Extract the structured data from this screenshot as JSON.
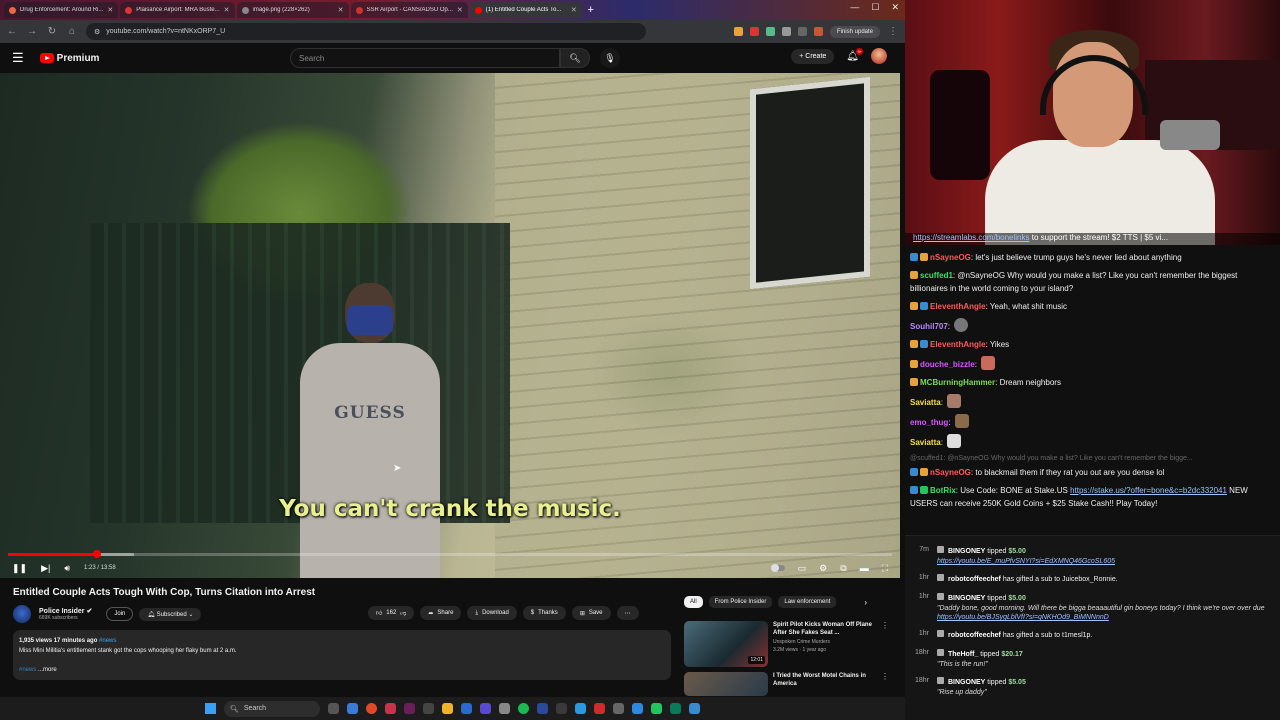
{
  "browser": {
    "tabs": [
      {
        "label": "Drug Enforcement: Around Ri..."
      },
      {
        "label": "Plaisance Airport: MRA Buste..."
      },
      {
        "label": "image.png (228×262)"
      },
      {
        "label": "SSR Airport - CANS/ADSU Op..."
      },
      {
        "label": "(1) Entitled Couple Acts To..."
      }
    ],
    "url": "youtube.com/watch?v=ntNKxORP7_U",
    "finish_update": "Finish update"
  },
  "youtube": {
    "logo_text": "Premium",
    "search_placeholder": "Search",
    "create_label": "Create",
    "notif_count": "9+",
    "caption": "You can't crank the music.",
    "time": "1:23 / 13:58",
    "progress_played": 0.101,
    "progress_loaded": 0.143,
    "title": "Entitled Couple Acts Tough With Cop, Turns Citation into Arrest",
    "channel": {
      "name": "Police Insider",
      "subs": "669K subscribers",
      "join": "Join",
      "subscribed": "Subscribed"
    },
    "actions": {
      "likes": "162",
      "share": "Share",
      "download": "Download",
      "thanks": "Thanks",
      "save": "Save"
    },
    "desc": {
      "meta": "1,935 views  17 minutes ago",
      "meta_tag": "#news",
      "text": "Miss Mini Militia's entitlement stank got the cops whooping her flaky bum at 2 a.m.",
      "tag": "#news",
      "more": "...more"
    },
    "chips": [
      "All",
      "From Police Insider",
      "Law enforcement"
    ],
    "recs": [
      {
        "title": "Spirit Pilot Kicks Woman Off Plane After She Fakes Seat ...",
        "channel": "Unspoken Crime Murders",
        "stats": "3.2M views · 1 year ago",
        "duration": "12:01"
      },
      {
        "title": "I Tried the Worst Motel Chains in America",
        "channel": "",
        "stats": "",
        "duration": ""
      }
    ]
  },
  "taskbar": {
    "search": "Search"
  },
  "stream": {
    "ticker_link": "https://streamlabs.com/bonelinks",
    "ticker_rest": " to support the stream! $2 TTS | $5 vi..."
  },
  "chat": [
    {
      "user": "nSayneOG",
      "color": "#ff5a5a",
      "text": "let's just believe trump guys he's never lied about anything"
    },
    {
      "user": "scuffed1",
      "color": "#3de06b",
      "text": "@nSayneOG Why would you make a list? Like you can't remember the biggest billionaires in the world coming to your island?"
    },
    {
      "user": "EleventhAngle",
      "color": "#ff5a5a",
      "text": "Yeah, what shit music"
    },
    {
      "user": "Souhil707",
      "color": "#b986ff",
      "text": ""
    },
    {
      "user": "EleventhAngle",
      "color": "#ff5a5a",
      "text": "Yikes"
    },
    {
      "user": "douche_bizzle",
      "color": "#d957ff",
      "text": ""
    },
    {
      "user": "MCBurningHammer",
      "color": "#7ed957",
      "text": "Dream neighbors"
    },
    {
      "user": "Saviatta",
      "color": "#f5e04a",
      "text": ""
    },
    {
      "user": "emo_thug",
      "color": "#d957ff",
      "text": ""
    },
    {
      "user": "Saviatta",
      "color": "#f5e04a",
      "text": ""
    },
    {
      "reply": "@scuffed1: @nSayneOG Why would you make a list? Like you can't remember the bigge..."
    },
    {
      "user": "nSayneOG",
      "color": "#ff5a5a",
      "text": "to blackmail them if they rat you out are you dense lol"
    },
    {
      "user": "BotRix",
      "color": "#3de06b",
      "text": "Use Code: BONE at Stake.US",
      "link": "https://stake.us/?offer=bone&c=b2dc332041",
      "text2": "NEW USERS can receive 250K Gold Coins + $25 Stake Cash!! Play Today!"
    }
  ],
  "tips": [
    {
      "time": "7m",
      "who": "BINGONEY",
      "action": "tipped",
      "amount": "$5.00",
      "msg": "",
      "link": "https://youtu.be/E_muPfvSNYI?si=EdXMNQ46GcoSL605"
    },
    {
      "time": "1hr",
      "who": "robotcoffeechef",
      "action": "has gifted a sub to Juicebox_Ronnie.",
      "amount": "",
      "msg": "",
      "link": ""
    },
    {
      "time": "1hr",
      "who": "BINGONEY",
      "action": "tipped",
      "amount": "$5.00",
      "msg": "\"Daddy bone, good morning. Will there be bigga beaaautiful gin boneys today? I think we're over over due ",
      "link": "https://youtu.be/BJSygLblVfI?si=qNKHOd9_BiMNNnnD"
    },
    {
      "time": "1hr",
      "who": "robotcoffeechef",
      "action": "has gifted a sub to t1mesl1p.",
      "amount": "",
      "msg": "",
      "link": ""
    },
    {
      "time": "18hr",
      "who": "TheHoff_",
      "action": "tipped",
      "amount": "$20.17",
      "msg": "\"This is the run!\"",
      "link": ""
    },
    {
      "time": "18hr",
      "who": "BINGONEY",
      "action": "tipped",
      "amount": "$5.05",
      "msg": "\"Rise up daddy\"",
      "link": ""
    }
  ]
}
